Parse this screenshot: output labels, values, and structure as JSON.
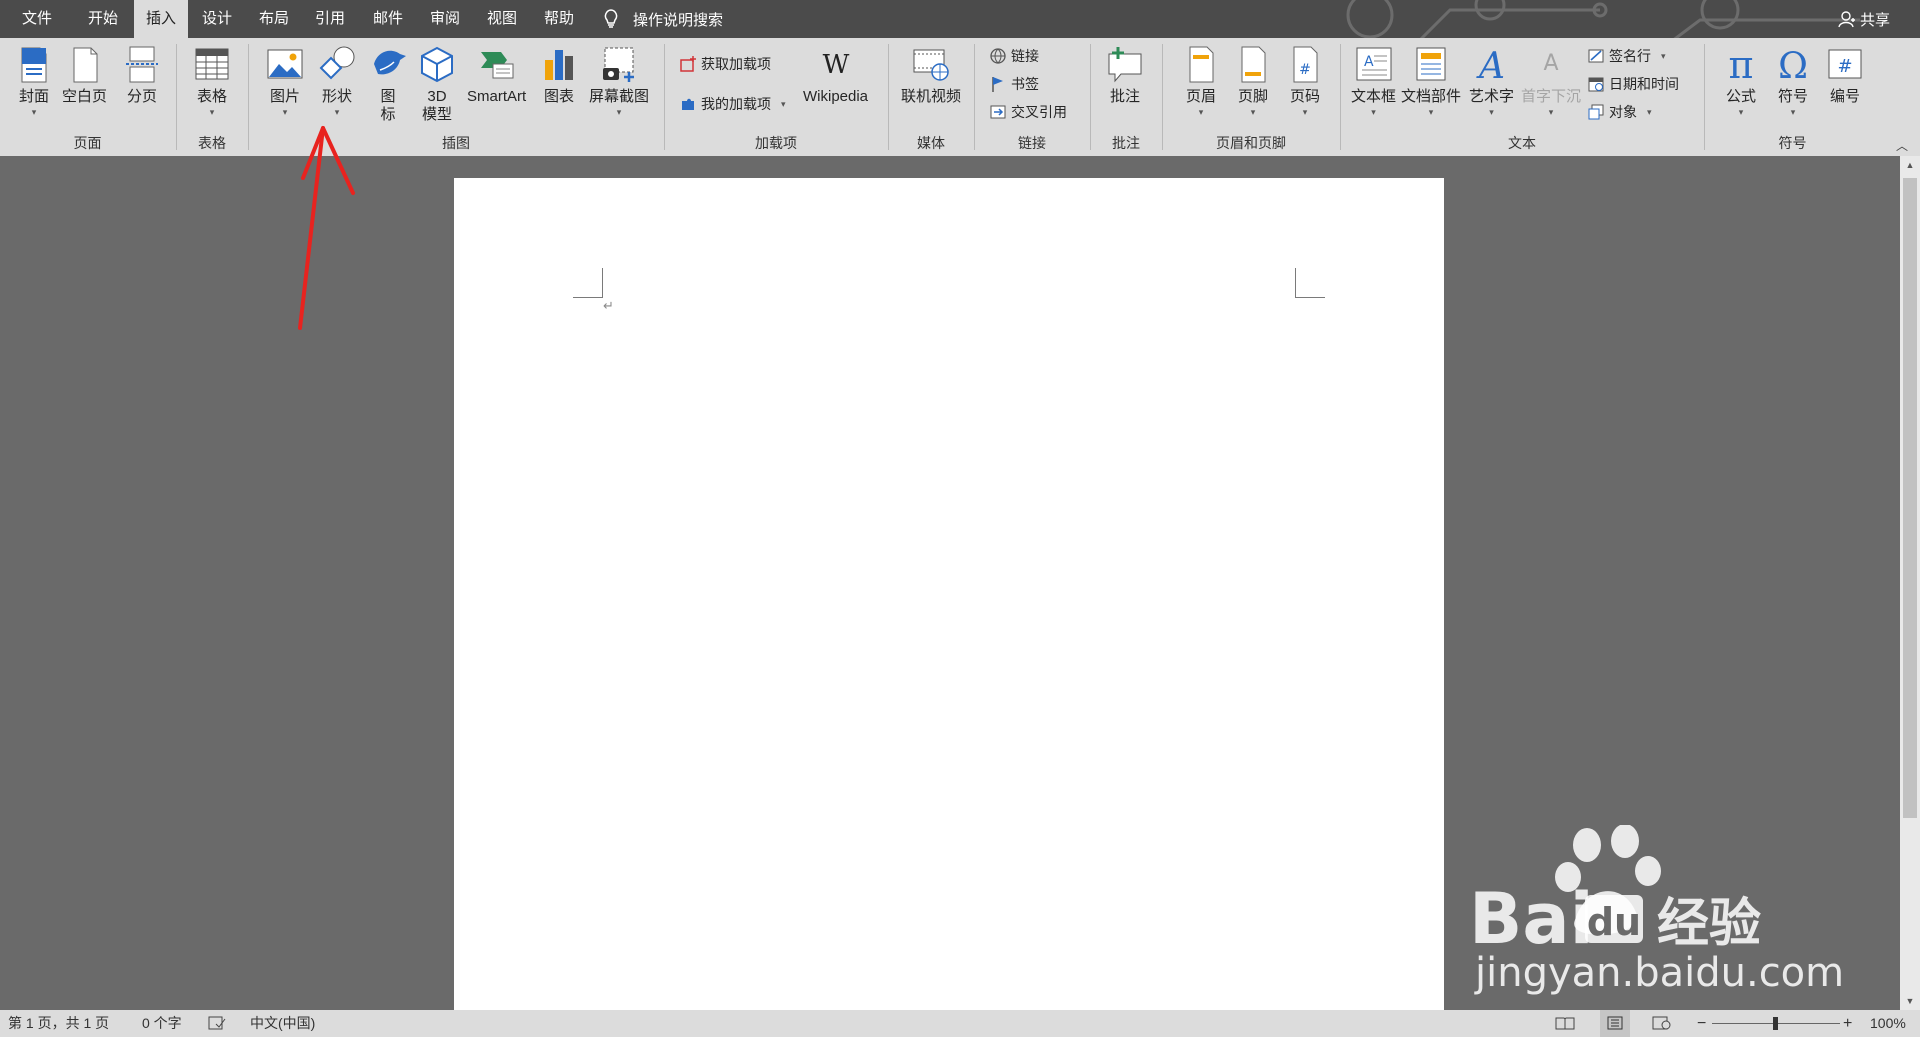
{
  "menubar": {
    "tabs": [
      "文件",
      "开始",
      "插入",
      "设计",
      "布局",
      "引用",
      "邮件",
      "审阅",
      "视图",
      "帮助"
    ],
    "active_tab": "插入",
    "tell_me": "操作说明搜索",
    "share": "共享"
  },
  "ribbon": {
    "groups": {
      "pages": {
        "label": "页面",
        "buttons": [
          "封面",
          "空白页",
          "分页"
        ]
      },
      "tables": {
        "label": "表格",
        "buttons": [
          "表格"
        ]
      },
      "illustrations": {
        "label": "插图",
        "buttons": [
          "图片",
          "形状",
          "图\n标",
          "3D\n模型",
          "SmartArt",
          "图表",
          "屏幕截图"
        ]
      },
      "addins": {
        "label": "加载项",
        "get": "获取加载项",
        "mine": "我的加载项",
        "wikipedia": "Wikipedia"
      },
      "media": {
        "label": "媒体",
        "buttons": [
          "联机视频"
        ]
      },
      "links": {
        "label": "链接",
        "buttons": [
          "链接",
          "书签",
          "交叉引用"
        ]
      },
      "comments": {
        "label": "批注",
        "buttons": [
          "批注"
        ]
      },
      "header_footer": {
        "label": "页眉和页脚",
        "buttons": [
          "页眉",
          "页脚",
          "页码"
        ]
      },
      "text": {
        "label": "文本",
        "buttons": [
          "文本框",
          "文档部件",
          "艺术字",
          "首字下沉"
        ],
        "small": [
          "签名行",
          "日期和时间",
          "对象"
        ]
      },
      "symbols": {
        "label": "符号",
        "buttons": [
          "公式",
          "符号",
          "编号"
        ]
      }
    }
  },
  "document": {
    "paragraph_mark": "↵"
  },
  "statusbar": {
    "page": "第 1 页，共 1 页",
    "words": "0 个字",
    "language": "中文(中国)",
    "zoom": "100%",
    "zoom_minus": "−",
    "zoom_plus": "+"
  },
  "watermark": {
    "brand": "Bai du 经验",
    "url": "jingyan.baidu.com"
  },
  "colors": {
    "accent_blue": "#2b6cc4",
    "annotation_red": "#e8231f",
    "ribbon_bg": "#dcdcdc",
    "menubar_bg": "#4b4b4b"
  }
}
